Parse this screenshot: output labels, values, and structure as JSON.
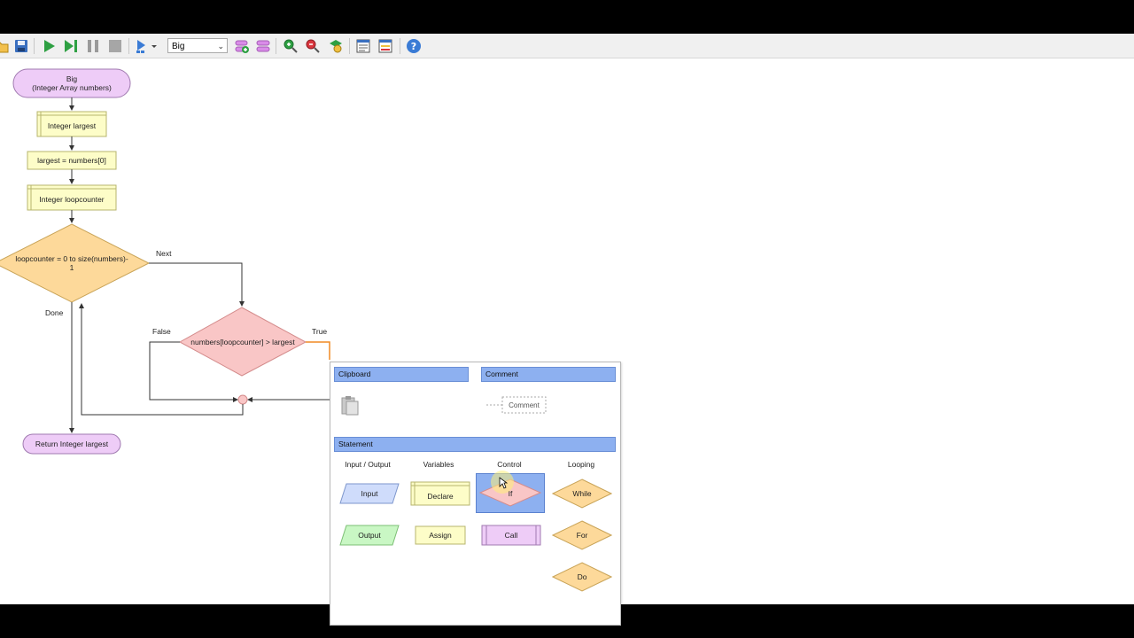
{
  "toolbar": {
    "function_select": "Big",
    "buttons": [
      "open-icon",
      "save-icon",
      "run-icon",
      "step-icon",
      "pause-icon",
      "stop-icon",
      "speed-icon",
      "add-function-icon",
      "delete-function-icon",
      "zoom-in-icon",
      "zoom-out-icon",
      "layout-icon",
      "code-view-icon",
      "variables-view-icon",
      "help-icon"
    ]
  },
  "flow": {
    "start": {
      "line1": "Big",
      "line2": "(Integer Array numbers)"
    },
    "declare_largest": "Integer largest",
    "assign_largest": "largest = numbers[0]",
    "declare_counter": "Integer loopcounter",
    "for_loop": {
      "line1": "loopcounter = 0 to size(numbers)-",
      "line2": "1"
    },
    "if_cond": "numbers[loopcounter] > largest",
    "label_next": "Next",
    "label_done": "Done",
    "label_false": "False",
    "label_true": "True",
    "end": "Return Integer largest"
  },
  "menu": {
    "clipboard": "Clipboard",
    "comment_head": "Comment",
    "comment_item": "Comment",
    "statement": "Statement",
    "columns": [
      "Input / Output",
      "Variables",
      "Control",
      "Looping"
    ],
    "items": {
      "input": "Input",
      "output": "Output",
      "declare": "Declare",
      "assign": "Assign",
      "if": "If",
      "call": "Call",
      "while": "While",
      "for": "For",
      "do": "Do"
    }
  },
  "colors": {
    "terminal": "#eeccf7",
    "process": "#fdfdc8",
    "loop": "#fdd99a",
    "if": "#f9c6c6",
    "input": "#cfdcfb",
    "output": "#c9f7c4",
    "menu_head": "#8db0f0",
    "selected": "#8db0f0"
  }
}
